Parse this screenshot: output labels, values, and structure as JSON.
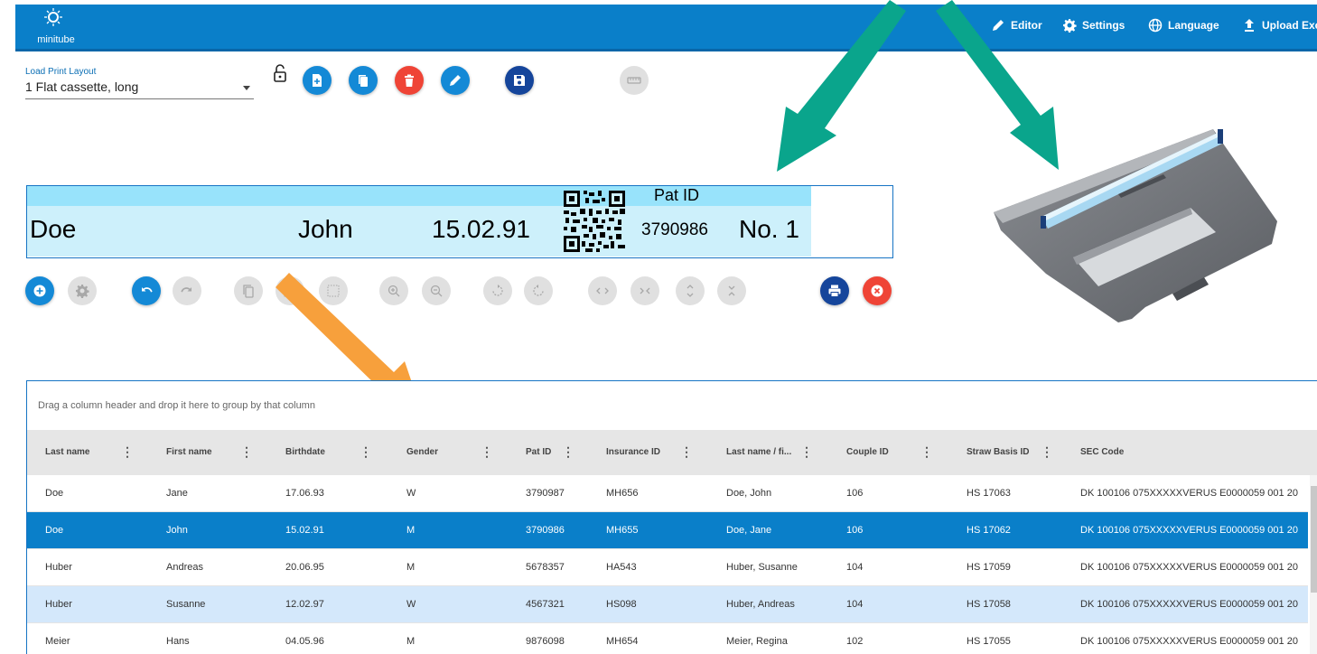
{
  "app": {
    "logo_text": "minitube",
    "nav": [
      {
        "icon": "pencil-icon",
        "label": "Editor"
      },
      {
        "icon": "gear-icon",
        "label": "Settings"
      },
      {
        "icon": "globe-icon",
        "label": "Language"
      },
      {
        "icon": "upload-icon",
        "label": "Upload Exce"
      }
    ]
  },
  "layout": {
    "label": "Load Print Layout",
    "selected": "1 Flat cassette, long"
  },
  "label_preview": {
    "last_name": "Doe",
    "first_name": "John",
    "birthdate": "15.02.91",
    "pat_id_label": "Pat ID",
    "pat_id": "3790986",
    "number": "No. 1"
  },
  "grid": {
    "group_hint": "Drag a column header and drop it here to group by that column",
    "columns": [
      "Last name",
      "First name",
      "Birthdate",
      "Gender",
      "Pat ID",
      "Insurance ID",
      "Last name / fi...",
      "Couple ID",
      "Straw Basis ID",
      "SEC Code"
    ],
    "rows": [
      [
        "Doe",
        "Jane",
        "17.06.93",
        "W",
        "3790987",
        "MH656",
        "Doe, John",
        "106",
        "HS 17063",
        "DK 100106 075XXXXXVERUS E0000059 001 20"
      ],
      [
        "Doe",
        "John",
        "15.02.91",
        "M",
        "3790986",
        "MH655",
        "Doe, Jane",
        "106",
        "HS 17062",
        "DK 100106 075XXXXXVERUS E0000059 001 20"
      ],
      [
        "Huber",
        "Andreas",
        "20.06.95",
        "M",
        "5678357",
        "HA543",
        "Huber, Susanne",
        "104",
        "HS 17059",
        "DK 100106 075XXXXXVERUS E0000059 001 20"
      ],
      [
        "Huber",
        "Susanne",
        "12.02.97",
        "W",
        "4567321",
        "HS098",
        "Huber, Andreas",
        "104",
        "HS 17058",
        "DK 100106 075XXXXXVERUS E0000059 001 20"
      ],
      [
        "Meier",
        "Hans",
        "04.05.96",
        "M",
        "9876098",
        "MH654",
        "Meier, Regina",
        "102",
        "HS 17055",
        "DK 100106 075XXXXXVERUS E0000059 001 20"
      ]
    ],
    "selected_row": 1
  },
  "colors": {
    "primary": "#0a7fc9",
    "navy": "#15459b",
    "danger": "#ef4436",
    "arrow_green": "#0aa58c",
    "arrow_orange": "#f7a03c"
  }
}
